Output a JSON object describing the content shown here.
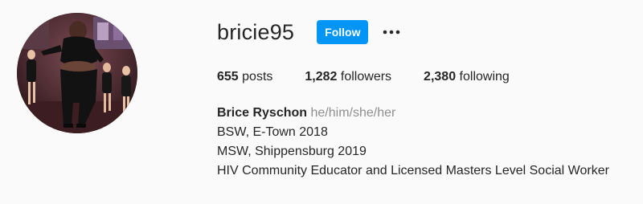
{
  "profile": {
    "username": "bricie95",
    "follow_label": "Follow",
    "more_icon": "more-horizontal-icon",
    "avatar_icon": "profile-photo",
    "stats": {
      "posts_count": "655",
      "posts_label": "posts",
      "followers_count": "1,282",
      "followers_label": "followers",
      "following_count": "2,380",
      "following_label": "following"
    },
    "bio": {
      "full_name": "Brice Ryschon",
      "pronouns": "he/him/she/her",
      "lines": [
        "BSW, E-Town 2018",
        "MSW, Shippensburg 2019",
        "HIV Community Educator and Licensed Masters Level Social Worker"
      ]
    }
  },
  "colors": {
    "accent": "#0095f6",
    "background": "#fafafa",
    "text": "#262626",
    "secondary_text": "#8e8e8e"
  }
}
